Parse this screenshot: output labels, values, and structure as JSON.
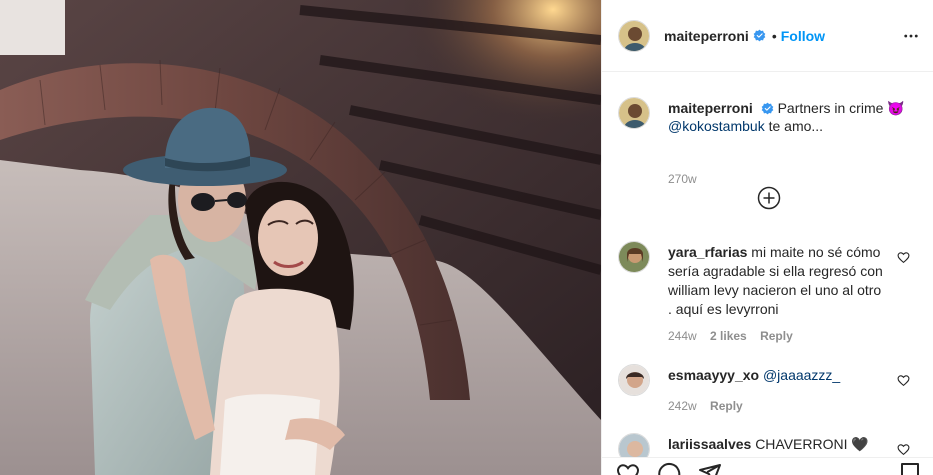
{
  "post": {
    "author": {
      "username": "maiteperroni",
      "follow_label": "Follow",
      "separator": "•"
    },
    "caption": {
      "username": "maiteperroni",
      "text_before_mention": "Partners in crime 😈",
      "mention": "@kokostambuk",
      "text_after_mention": " te amo...",
      "age": "270w"
    },
    "comments": [
      {
        "username": "yara_rfarias",
        "text": "mi maite no sé cómo sería agradable si ella regresó con william levy nacieron el uno al otro . aquí es levyrroni",
        "age": "244w",
        "likes": "2 likes",
        "reply_label": "Reply"
      },
      {
        "username": "esmaayyy_xo",
        "text": "",
        "mention": "@jaaaazzz_",
        "age": "242w",
        "reply_label": "Reply"
      },
      {
        "username": "lariissaalves",
        "text": "CHAVERRONI 🖤"
      }
    ]
  },
  "icons": {
    "verified": "verified-badge-icon",
    "more": "more-options-icon",
    "load_more": "plus-circle-icon",
    "like": "heart-icon",
    "comment": "comment-bubble-icon",
    "share": "paper-plane-icon",
    "save": "bookmark-icon"
  },
  "colors": {
    "accent": "#0095f6",
    "verified": "#3897f0",
    "muted": "#8e8e8e",
    "text": "#262626",
    "border": "#efefef"
  }
}
